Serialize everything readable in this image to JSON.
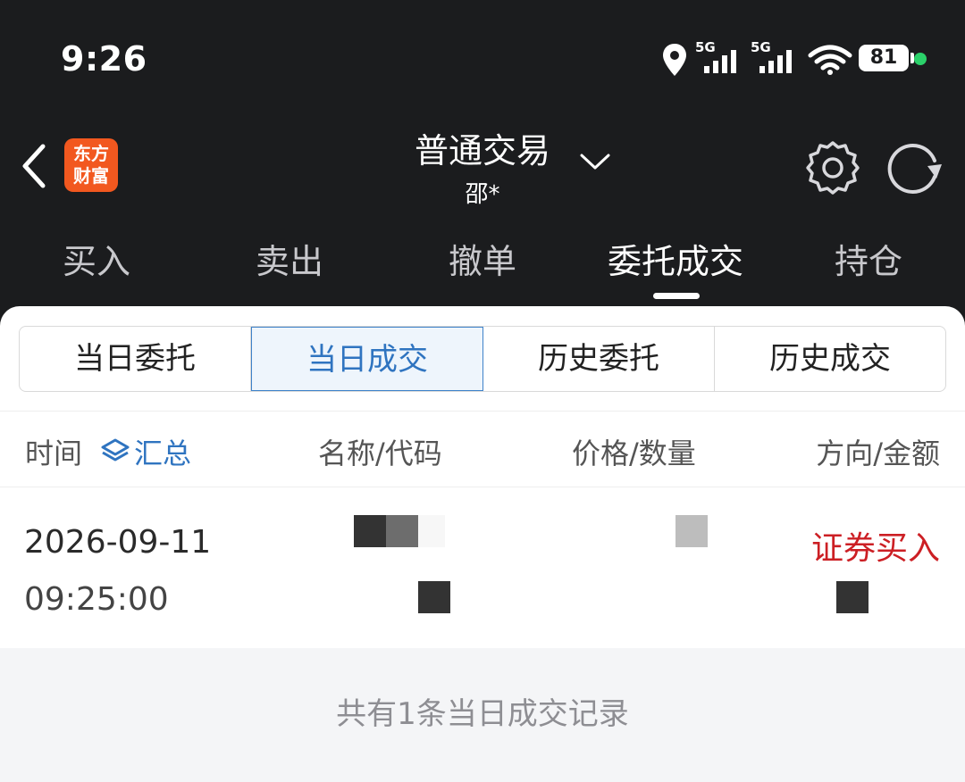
{
  "status_bar": {
    "time": "9:26",
    "network_1": "5G",
    "network_2": "5G",
    "battery": "81",
    "icons": [
      "location-icon",
      "signal-icon",
      "signal-icon",
      "wifi-icon",
      "battery-icon"
    ]
  },
  "header": {
    "logo_line1": "东方",
    "logo_line2": "财富",
    "title": "普通交易",
    "subtitle": "邵*",
    "logo_color": "#f2581f"
  },
  "main_tabs": [
    {
      "label": "买入"
    },
    {
      "label": "卖出"
    },
    {
      "label": "撤单"
    },
    {
      "label": "委托成交",
      "active": true
    },
    {
      "label": "持仓"
    }
  ],
  "sub_tabs": [
    {
      "label": "当日委托"
    },
    {
      "label": "当日成交",
      "active": true
    },
    {
      "label": "历史委托"
    },
    {
      "label": "历史成交"
    }
  ],
  "table": {
    "col_time": "时间",
    "summary": "汇总",
    "col_name": "名称/代码",
    "col_price": "价格/数量",
    "col_direction": "方向/金额",
    "rows": [
      {
        "date": "2026-09-11",
        "time": "09:25:00",
        "direction": "证券买入"
      }
    ]
  },
  "footer": {
    "text": "共有1条当日成交记录"
  },
  "colors": {
    "accent": "#2f74c0",
    "buy_red": "#cc1f24",
    "dark_bg": "#1b1c1e"
  }
}
